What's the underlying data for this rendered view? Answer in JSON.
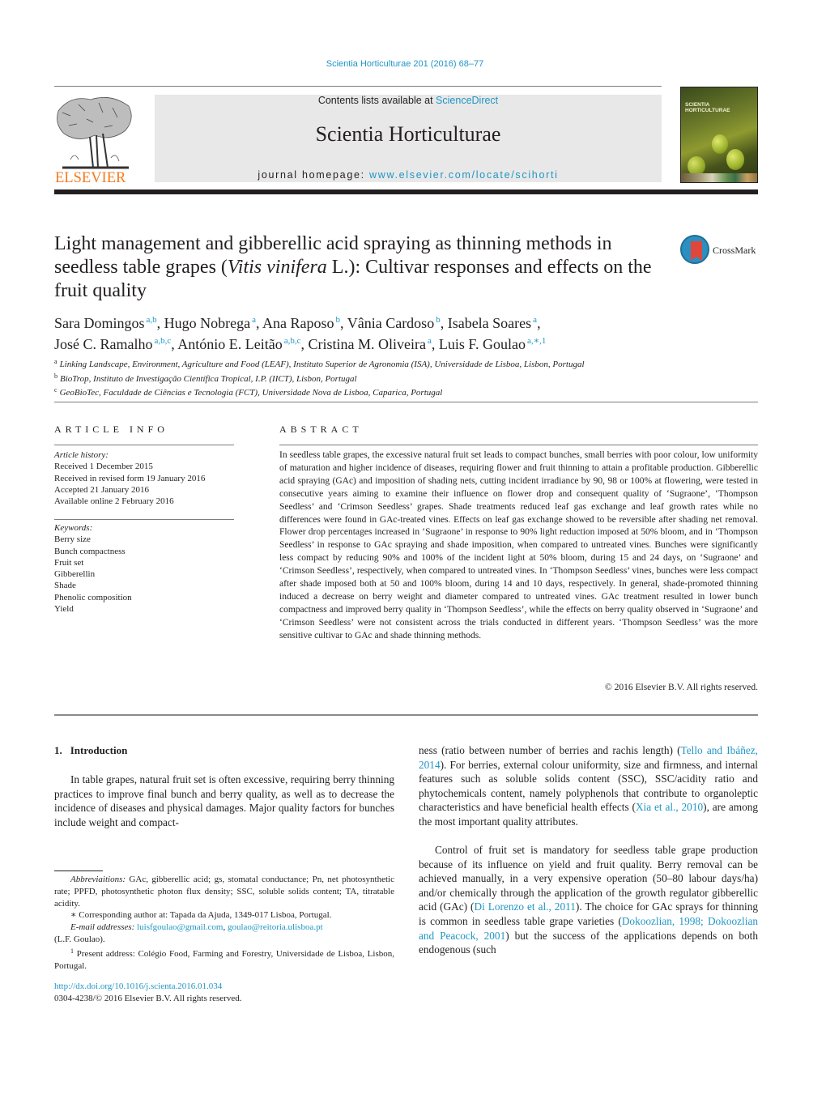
{
  "header": {
    "journal_ref": "Scientia Horticulturae 201 (2016) 68–77",
    "contents_prefix": "Contents lists available at ",
    "contents_link": "ScienceDirect",
    "journal_title": "Scientia Horticulturae",
    "homepage_prefix": "journal homepage: ",
    "homepage_link": "www.elsevier.com/locate/scihorti",
    "publisher_logo_text": "ELSEVIER",
    "cover_title_line1": "SCIENTIA",
    "cover_title_line2": "HORTICULTURAE",
    "crossmark_label": "CrossMark"
  },
  "article": {
    "title_part1": "Light management and gibberellic acid spraying as thinning methods in seedless table grapes (",
    "title_italic": "Vitis vinifera",
    "title_part2": " L.): Cultivar responses and effects on the fruit quality",
    "authors": [
      {
        "name": "Sara Domingos",
        "aff": "a,b",
        "sep": ", "
      },
      {
        "name": "Hugo Nobrega",
        "aff": "a",
        "sep": ", "
      },
      {
        "name": "Ana Raposo",
        "aff": "b",
        "sep": ", "
      },
      {
        "name": "Vânia Cardoso",
        "aff": "b",
        "sep": ", "
      },
      {
        "name": "Isabela Soares",
        "aff": "a",
        "sep": ","
      },
      {
        "name": "José C. Ramalho",
        "aff": "a,b,c",
        "sep": ", "
      },
      {
        "name": "António E. Leitão",
        "aff": "a,b,c",
        "sep": ", "
      },
      {
        "name": "Cristina M. Oliveira",
        "aff": "a",
        "sep": ", "
      },
      {
        "name": "Luis F. Goulao",
        "aff": "a,∗,1",
        "sep": ""
      }
    ],
    "affiliations": [
      {
        "mark": "a",
        "text": "Linking Landscape, Environment, Agriculture and Food (LEAF), Instituto Superior de Agronomia (ISA), Universidade de Lisboa, Lisbon, Portugal"
      },
      {
        "mark": "b",
        "text": "BioTrop, Instituto de Investigação Científica Tropical, I.P. (IICT), Lisbon, Portugal"
      },
      {
        "mark": "c",
        "text": "GeoBioTec, Faculdade de Ciências e Tecnologia (FCT), Universidade Nova de Lisboa, Caparica, Portugal"
      }
    ]
  },
  "article_info": {
    "heading": "ARTICLE INFO",
    "history_label": "Article history:",
    "history": [
      "Received 1 December 2015",
      "Received in revised form 19 January 2016",
      "Accepted 21 January 2016",
      "Available online 2 February 2016"
    ],
    "keywords_label": "Keywords:",
    "keywords": [
      "Berry size",
      "Bunch compactness",
      "Fruit set",
      "Gibberellin",
      "Shade",
      "Phenolic composition",
      "Yield"
    ]
  },
  "abstract": {
    "heading": "ABSTRACT",
    "text": "In seedless table grapes, the excessive natural fruit set leads to compact bunches, small berries with poor colour, low uniformity of maturation and higher incidence of diseases, requiring flower and fruit thinning to attain a profitable production. Gibberellic acid spraying (GAc) and imposition of shading nets, cutting incident irradiance by 90, 98 or 100% at flowering, were tested in consecutive years aiming to examine their influence on flower drop and consequent quality of ‘Sugraone’, ‘Thompson Seedless’ and ‘Crimson Seedless’ grapes. Shade treatments reduced leaf gas exchange and leaf growth rates while no differences were found in GAc-treated vines. Effects on leaf gas exchange showed to be reversible after shading net removal. Flower drop percentages increased in ‘Sugraone’ in response to 90% light reduction imposed at 50% bloom, and in ‘Thompson Seedless’ in response to GAc spraying and shade imposition, when compared to untreated vines. Bunches were significantly less compact by reducing 90% and 100% of the incident light at 50% bloom, during 15 and 24 days, on ‘Sugraone’ and ‘Crimson Seedless’, respectively, when compared to untreated vines. In ‘Thompson Seedless’ vines, bunches were less compact after shade imposed both at 50 and 100% bloom, during 14 and 10 days, respectively. In general, shade-promoted thinning induced a decrease on berry weight and diameter compared to untreated vines. GAc treatment resulted in lower bunch compactness and improved berry quality in ‘Thompson Seedless’, while the effects on berry quality observed in ‘Sugraone’ and ‘Crimson Seedless’ were not consistent across the trials conducted in different years. ‘Thompson Seedless’ was the more sensitive cultivar to GAc and shade thinning methods.",
    "copyright": "© 2016 Elsevier B.V. All rights reserved."
  },
  "introduction": {
    "number": "1.",
    "title": "Introduction",
    "col1_paragraph": "In table grapes, natural fruit set is often excessive, requiring berry thinning practices to improve final bunch and berry quality, as well as to decrease the incidence of diseases and physical damages. Major quality factors for bunches include weight and compact-",
    "col2_p1_a": "ness (ratio between number of berries and rachis length) (",
    "col2_p1_cite1": "Tello and Ibáñez, 2014",
    "col2_p1_b": "). For berries, external colour uniformity, size and firmness, and internal features such as soluble solids content (SSC), SSC/acidity ratio and phytochemicals content, namely polyphenols that contribute to organoleptic characteristics and have beneficial health effects (",
    "col2_p1_cite2": "Xia et al., 2010",
    "col2_p1_c": "), are among the most important quality attributes.",
    "col2_p2_a": "Control of fruit set is mandatory for seedless table grape production because of its influence on yield and fruit quality. Berry removal can be achieved manually, in a very expensive operation (50–80 labour days/ha) and/or chemically through the application of the growth regulator gibberellic acid (GAc) (",
    "col2_p2_cite1": "Di Lorenzo et al., 2011",
    "col2_p2_b": "). The choice for GAc sprays for thinning is common in seedless table grape varieties (",
    "col2_p2_cite2": "Dokoozlian, 1998; Dokoozlian and Peacock, 2001",
    "col2_p2_c": ") but the success of the applications depends on both endogenous (such"
  },
  "footnotes": {
    "abbrev_label": "Abbreviaitions:",
    "abbrev_text": " GAc, gibberellic acid; gs, stomatal conductance; Pn, net photosynthetic rate; PPFD, photosynthetic photon flux density; SSC, soluble solids content; TA, titratable acidity.",
    "corresponding_mark": "∗",
    "corresponding_text": " Corresponding author at: Tapada da Ajuda, 1349-017 Lisboa, Portugal.",
    "email_label": "E-mail addresses:",
    "email1": "luisfgoulao@gmail.com",
    "email_sep": ", ",
    "email2": "goulao@reitoria.ulisboa.pt",
    "email_owner": "(L.F. Goulao).",
    "present_mark": "1",
    "present_text": " Present address: Colégio Food, Farming and Forestry, Universidade de Lisboa, Lisbon, Portugal."
  },
  "doi": {
    "link": "http://dx.doi.org/10.1016/j.scienta.2016.01.034",
    "issn_line": "0304-4238/© 2016 Elsevier B.V. All rights reserved."
  },
  "colors": {
    "link_blue": "#2196c4",
    "elsevier_orange": "#f47b20",
    "masthead_gray": "#e8e8e8",
    "text": "#231f20"
  }
}
